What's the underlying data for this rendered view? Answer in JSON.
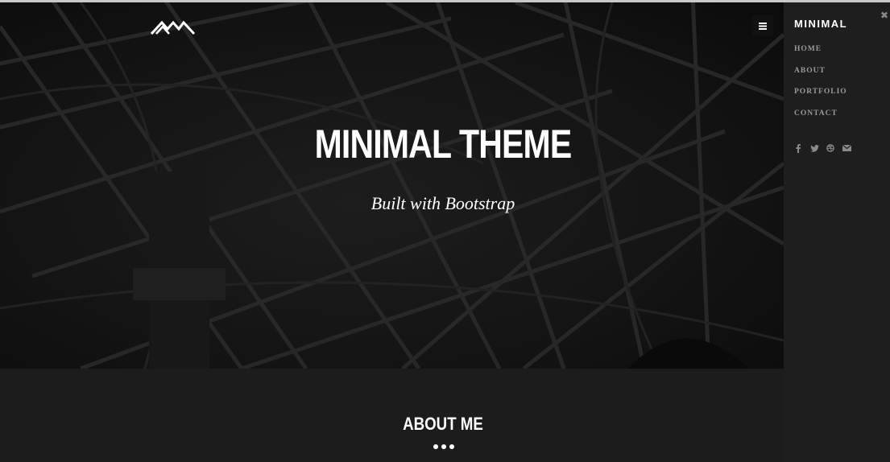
{
  "hero": {
    "title": "MINIMAL THEME",
    "subtitle": "Built with Bootstrap"
  },
  "icons": {
    "logo": "mountains-logo-icon",
    "menu": "hamburger-menu-icon",
    "close": "close-icon",
    "social": [
      "facebook-icon",
      "twitter-icon",
      "dribbble-icon",
      "email-icon"
    ]
  },
  "sidebar": {
    "brand": "MINIMAL",
    "close_glyph": "✖",
    "items": [
      {
        "label": "HOME"
      },
      {
        "label": "ABOUT"
      },
      {
        "label": "PORTFOLIO"
      },
      {
        "label": "CONTACT"
      }
    ]
  },
  "about": {
    "title": "ABOUT ME"
  },
  "colors": {
    "background": "#1c1c1c",
    "sidebar": "#1e1e1e",
    "text": "#ffffff",
    "nav_text": "#9a9a9a"
  }
}
